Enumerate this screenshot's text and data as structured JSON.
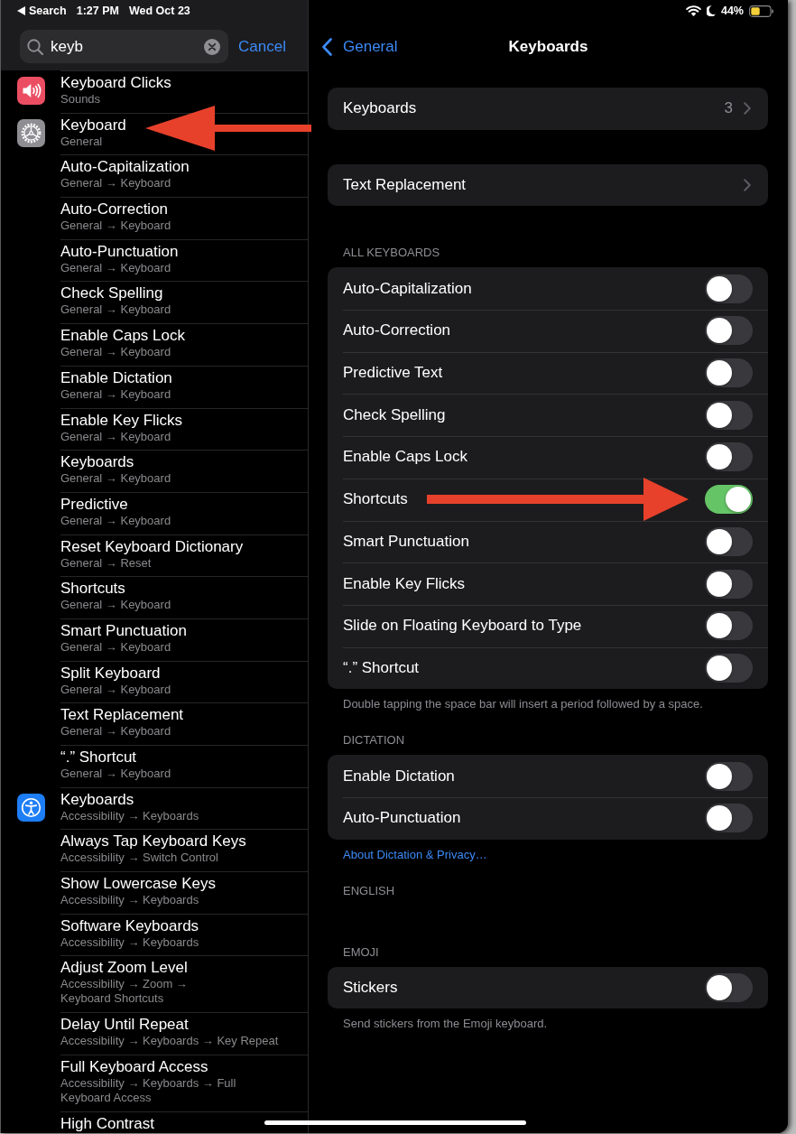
{
  "status_bar": {
    "back_app": "Search",
    "time": "1:27 PM",
    "date": "Wed Oct 23",
    "battery": "44%"
  },
  "sidebar": {
    "search": {
      "value": "keyb",
      "cancel": "Cancel"
    },
    "result_groups": [
      {
        "kind": "sounds",
        "results": [
          {
            "title": "Keyboard Clicks",
            "subtitle": "Sounds"
          }
        ]
      },
      {
        "kind": "general",
        "results": [
          {
            "title": "Keyboard",
            "subtitle": "General"
          },
          {
            "title": "Auto-Capitalization",
            "subtitle": "General → Keyboard"
          },
          {
            "title": "Auto-Correction",
            "subtitle": "General → Keyboard"
          },
          {
            "title": "Auto-Punctuation",
            "subtitle": "General → Keyboard"
          },
          {
            "title": "Check Spelling",
            "subtitle": "General → Keyboard"
          },
          {
            "title": "Enable Caps Lock",
            "subtitle": "General → Keyboard"
          },
          {
            "title": "Enable Dictation",
            "subtitle": "General → Keyboard"
          },
          {
            "title": "Enable Key Flicks",
            "subtitle": "General → Keyboard"
          },
          {
            "title": "Keyboards",
            "subtitle": "General → Keyboard"
          },
          {
            "title": "Predictive",
            "subtitle": "General → Keyboard"
          },
          {
            "title": "Reset Keyboard Dictionary",
            "subtitle": "General → Reset"
          },
          {
            "title": "Shortcuts",
            "subtitle": "General → Keyboard"
          },
          {
            "title": "Smart Punctuation",
            "subtitle": "General → Keyboard"
          },
          {
            "title": "Split Keyboard",
            "subtitle": "General → Keyboard"
          },
          {
            "title": "Text Replacement",
            "subtitle": "General → Keyboard"
          },
          {
            "title": "“.” Shortcut",
            "subtitle": "General → Keyboard"
          }
        ]
      },
      {
        "kind": "accessibility",
        "results": [
          {
            "title": "Keyboards",
            "subtitle": "Accessibility → Keyboards"
          },
          {
            "title": "Always Tap Keyboard Keys",
            "subtitle": "Accessibility → Switch Control"
          },
          {
            "title": "Show Lowercase Keys",
            "subtitle": "Accessibility → Keyboards"
          },
          {
            "title": "Software Keyboards",
            "subtitle": "Accessibility → Keyboards"
          },
          {
            "title": "Adjust Zoom Level",
            "subtitle": "Accessibility → Zoom →\nKeyboard Shortcuts"
          },
          {
            "title": "Delay Until Repeat",
            "subtitle": "Accessibility → Keyboards → Key Repeat"
          },
          {
            "title": "Full Keyboard Access",
            "subtitle": "Accessibility → Keyboards → Full\nKeyboard Access"
          },
          {
            "title": "High Contrast"
          }
        ]
      }
    ]
  },
  "settings": {
    "back": "General",
    "title": "Keyboards",
    "sections": [
      {
        "rows": [
          {
            "kind": "link",
            "label": "Keyboards",
            "value": "3"
          }
        ]
      },
      {
        "rows": [
          {
            "kind": "link",
            "label": "Text Replacement"
          }
        ]
      },
      {
        "header": "ALL KEYBOARDS",
        "rows": [
          {
            "kind": "toggle",
            "label": "Auto-Capitalization",
            "on": false
          },
          {
            "kind": "toggle",
            "label": "Auto-Correction",
            "on": false
          },
          {
            "kind": "toggle",
            "label": "Predictive Text",
            "on": false
          },
          {
            "kind": "toggle",
            "label": "Check Spelling",
            "on": false
          },
          {
            "kind": "toggle",
            "label": "Enable Caps Lock",
            "on": false
          },
          {
            "kind": "toggle",
            "label": "Shortcuts",
            "on": true
          },
          {
            "kind": "toggle",
            "label": "Smart Punctuation",
            "on": false
          },
          {
            "kind": "toggle",
            "label": "Enable Key Flicks",
            "on": false
          },
          {
            "kind": "toggle",
            "label": "Slide on Floating Keyboard to Type",
            "on": false
          },
          {
            "kind": "toggle",
            "label": "“.” Shortcut",
            "on": false
          }
        ],
        "footer": "Double tapping the space bar will insert a period followed by a space."
      },
      {
        "header": "DICTATION",
        "rows": [
          {
            "kind": "toggle",
            "label": "Enable Dictation",
            "on": false
          },
          {
            "kind": "toggle",
            "label": "Auto-Punctuation",
            "on": false
          }
        ],
        "link": "About Dictation & Privacy…"
      },
      {
        "header": "ENGLISH"
      },
      {
        "header": "EMOJI",
        "rows": [
          {
            "kind": "toggle",
            "label": "Stickers",
            "on": false
          }
        ],
        "footer": "Send stickers from the Emoji keyboard."
      }
    ]
  }
}
